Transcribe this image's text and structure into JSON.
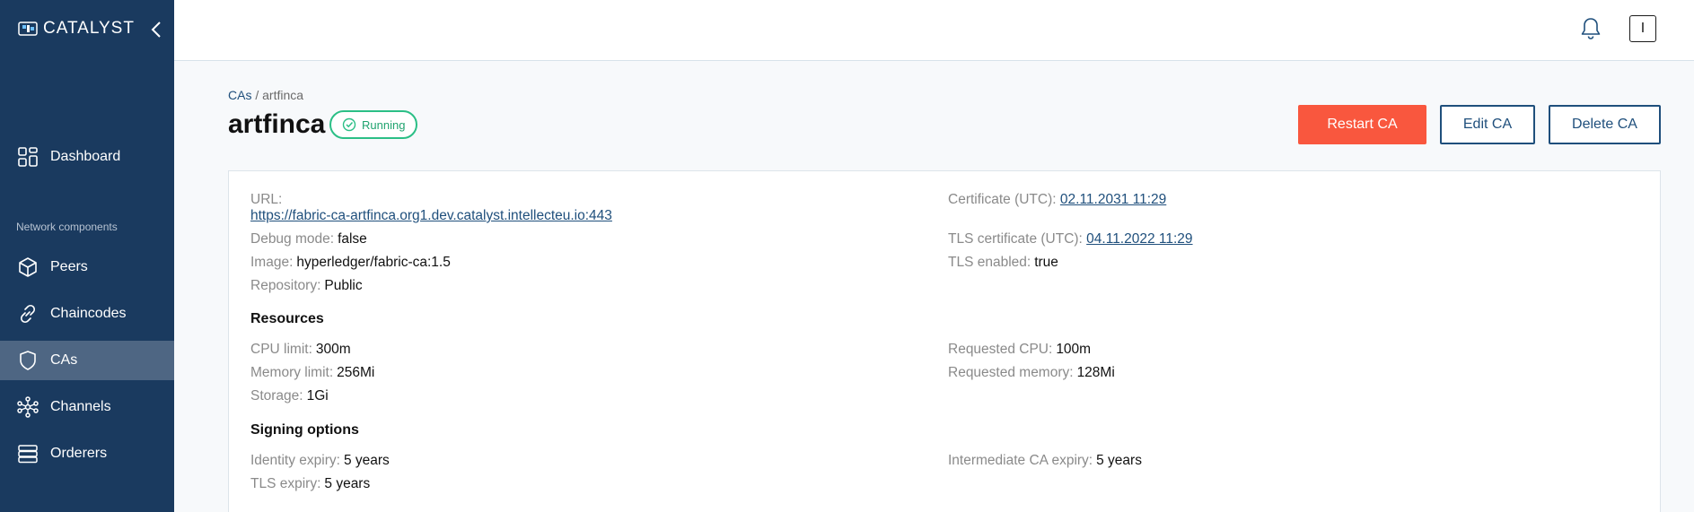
{
  "app": {
    "logo_text": "CATALYST"
  },
  "sidebar": {
    "section_label": "Network components",
    "items": [
      {
        "label": "Dashboard",
        "icon": "dashboard-icon"
      },
      {
        "label": "Peers",
        "icon": "cube-icon"
      },
      {
        "label": "Chaincodes",
        "icon": "link-icon"
      },
      {
        "label": "CAs",
        "icon": "shield-icon",
        "active": true
      },
      {
        "label": "Channels",
        "icon": "network-icon"
      },
      {
        "label": "Orderers",
        "icon": "server-icon"
      }
    ]
  },
  "topbar": {
    "avatar_initial": "I"
  },
  "breadcrumb": {
    "root": "CAs",
    "separator": "/",
    "current": "artfinca"
  },
  "page": {
    "title": "artfinca",
    "status": "Running",
    "status_color": "#2bbf86"
  },
  "actions": {
    "restart": "Restart CA",
    "edit": "Edit CA",
    "delete": "Delete CA",
    "restart_color": "#f9573e"
  },
  "details": {
    "url_label": "URL:",
    "url_value": "https://fabric-ca-artfinca.org1.dev.catalyst.intellecteu.io:443",
    "debug_label": "Debug mode:",
    "debug_value": "false",
    "image_label": "Image:",
    "image_value": "hyperledger/fabric-ca:1.5",
    "repo_label": "Repository:",
    "repo_value": "Public",
    "cert_label": "Certificate (UTC):",
    "cert_value": "02.11.2031 11:29",
    "tls_cert_label": "TLS certificate (UTC):",
    "tls_cert_value": "04.11.2022 11:29",
    "tls_enabled_label": "TLS enabled:",
    "tls_enabled_value": "true"
  },
  "resources": {
    "heading": "Resources",
    "cpu_limit_label": "CPU limit:",
    "cpu_limit_value": "300m",
    "mem_limit_label": "Memory limit:",
    "mem_limit_value": "256Mi",
    "storage_label": "Storage:",
    "storage_value": "1Gi",
    "req_cpu_label": "Requested CPU:",
    "req_cpu_value": "100m",
    "req_mem_label": "Requested memory:",
    "req_mem_value": "128Mi"
  },
  "signing": {
    "heading": "Signing options",
    "identity_label": "Identity expiry:",
    "identity_value": "5 years",
    "tls_label": "TLS expiry:",
    "tls_value": "5 years",
    "intermediate_label": "Intermediate CA expiry:",
    "intermediate_value": "5 years"
  }
}
